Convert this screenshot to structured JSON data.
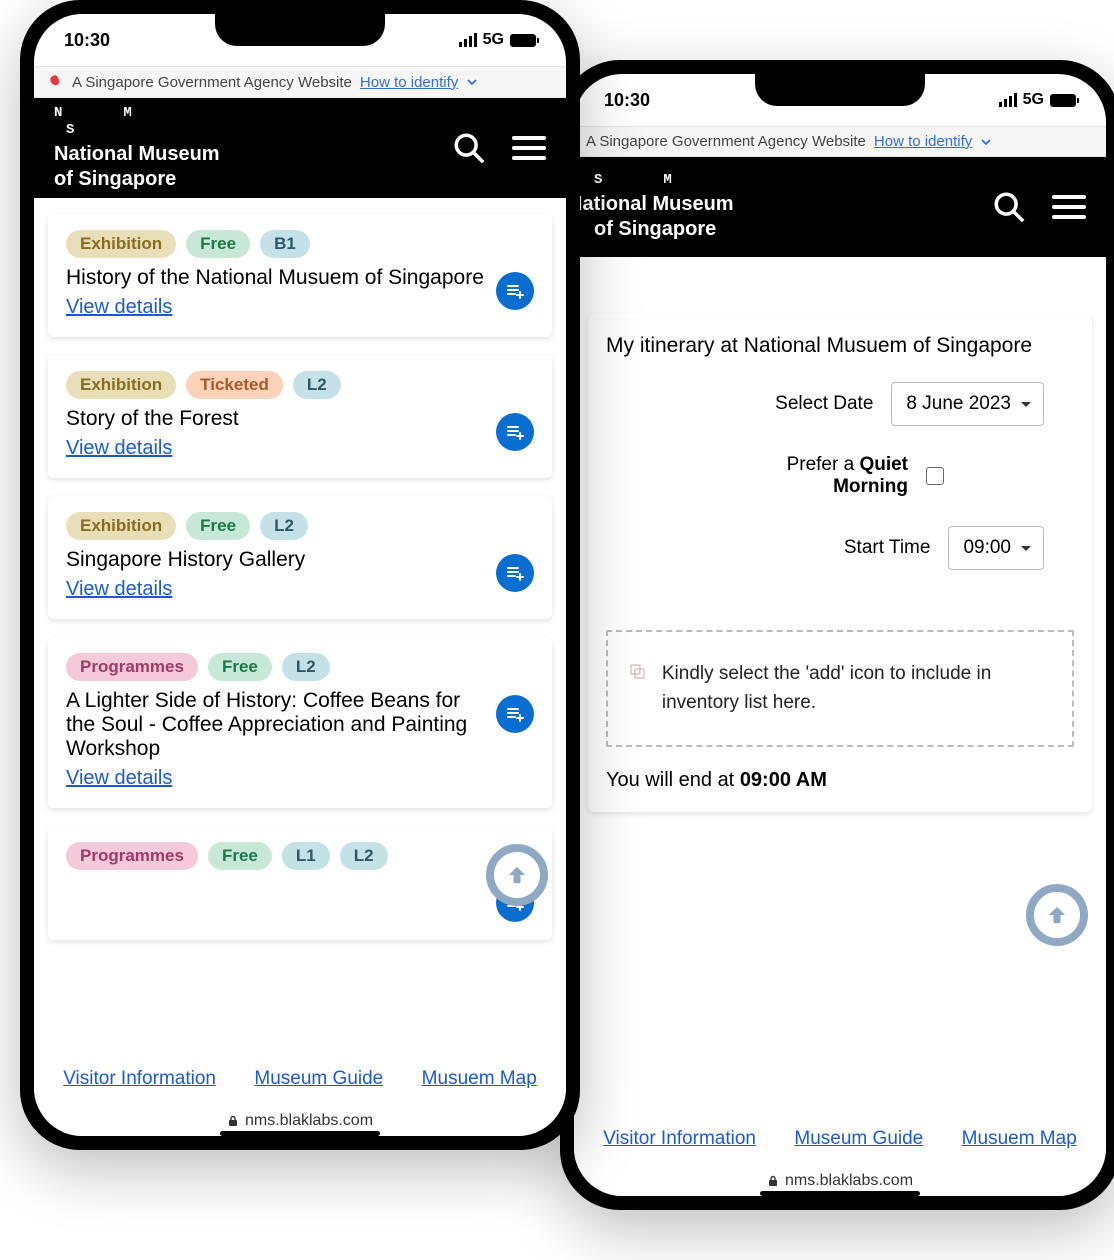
{
  "statusTime": "10:30",
  "network": "5G",
  "govText": "A Singapore Government Agency Website",
  "govLink": "How to identify",
  "brand": {
    "mono1": "N",
    "mono2": "M",
    "mono3": "S",
    "line1": "National Museum",
    "line2": "of Singapore"
  },
  "cards": [
    {
      "tags": [
        [
          "exhib",
          "Exhibition"
        ],
        [
          "free",
          "Free"
        ],
        [
          "lvl",
          "B1"
        ]
      ],
      "title": "History of the National Musuem of Singapore",
      "link": "View details"
    },
    {
      "tags": [
        [
          "exhib",
          "Exhibition"
        ],
        [
          "tick",
          "Ticketed"
        ],
        [
          "lvl",
          "L2"
        ]
      ],
      "title": "Story of the Forest",
      "link": "View details"
    },
    {
      "tags": [
        [
          "exhib",
          "Exhibition"
        ],
        [
          "free",
          "Free"
        ],
        [
          "lvl",
          "L2"
        ]
      ],
      "title": "Singapore History Gallery",
      "link": "View details"
    },
    {
      "tags": [
        [
          "prog",
          "Programmes"
        ],
        [
          "free",
          "Free"
        ],
        [
          "lvl",
          "L2"
        ]
      ],
      "title": "A Lighter Side of History: Coffee Beans for the Soul - Coffee Appreciation and Painting Workshop",
      "link": "View details"
    },
    {
      "tags": [
        [
          "prog",
          "Programmes"
        ],
        [
          "free",
          "Free"
        ],
        [
          "lvl",
          "L1"
        ],
        [
          "lvl",
          "L2"
        ]
      ],
      "title": "",
      "link": ""
    }
  ],
  "footerLinks": [
    "Visitor Information",
    "Museum Guide",
    "Musuem Map"
  ],
  "url": "nms.blaklabs.com",
  "itinerary": {
    "heading": "My itinerary at National Musuem of Singapore",
    "dateLabel": "Select Date",
    "dateValue": "8 June 2023",
    "quietLabel1": "Prefer a ",
    "quietLabel2": "Quiet Morning",
    "timeLabel": "Start Time",
    "timeValue": "09:00",
    "dropText": "Kindly select the 'add' icon to include in inventory list here.",
    "endText1": "You will end at ",
    "endText2": "09:00 AM"
  }
}
